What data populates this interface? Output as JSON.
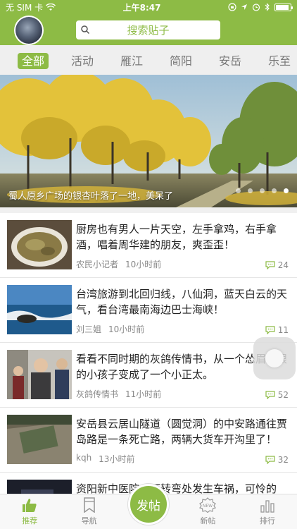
{
  "status": {
    "carrier": "无 SIM 卡",
    "time": "上午8:47",
    "battery_level": 0.9
  },
  "header": {
    "search_placeholder": "搜索贴子"
  },
  "tabs": [
    {
      "label": "全部",
      "active": true
    },
    {
      "label": "活动",
      "active": false
    },
    {
      "label": "雁江",
      "active": false
    },
    {
      "label": "简阳",
      "active": false
    },
    {
      "label": "安岳",
      "active": false
    },
    {
      "label": "乐至",
      "active": false
    }
  ],
  "banner": {
    "caption": "蜀人原乡广场的银杏叶落了一地，美呆了",
    "slide_count": 5,
    "active_slide": 4
  },
  "feed": [
    {
      "title": "厨房也有男人一片天空，左手拿鸡，右手拿酒，唱着周华建的朋友，爽歪歪！",
      "author": "农民小记者",
      "time": "10小时前",
      "comments": "24"
    },
    {
      "title": "台湾旅游到北回归线，八仙洞，蓝天白云的天气，看台湾最南海边巴士海峡！",
      "author": "刘三姐",
      "time": "10小时前",
      "comments": "11"
    },
    {
      "title": "看看不同时期的灰鸽传情书，从一个怂眉怂眼的小孩子变成了一个小正太。",
      "author": "灰鸽传情书",
      "time": "11小时前",
      "comments": "52"
    },
    {
      "title": "安岳县云居山隧道（圆觉洞）的中安路通往贾岛路是一条死亡路，两辆大货车开沟里了！",
      "author": "kqh",
      "time": "13小时前",
      "comments": "32"
    },
    {
      "title": "资阳新中医院对面转弯处发生车祸，可怜的",
      "author": "",
      "time": "",
      "comments": ""
    }
  ],
  "bottom_nav": [
    {
      "label": "推荐",
      "icon": "thumbs-up-icon",
      "active": true
    },
    {
      "label": "导航",
      "icon": "bookmark-icon",
      "active": false
    },
    {
      "label": "新帖",
      "icon": "new-badge-icon",
      "active": false
    },
    {
      "label": "排行",
      "icon": "bar-chart-icon",
      "active": false
    }
  ],
  "post_button_label": "发帖",
  "colors": {
    "brand_green": "#8dbb45",
    "tab_bg": "#efefef"
  }
}
